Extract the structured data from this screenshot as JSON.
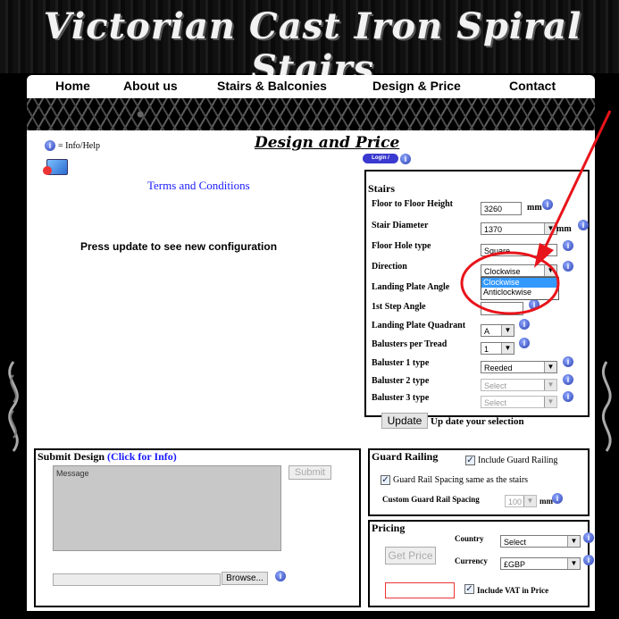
{
  "site": {
    "title": "Victorian Cast Iron Spiral Stairs"
  },
  "nav": {
    "items": [
      "Home",
      "About us",
      "Stairs & Balconies",
      "Design & Price",
      "Contact"
    ]
  },
  "page": {
    "info_help_label": "= Info/Help",
    "heading": "Design and Price",
    "login_label": "Login / Register",
    "terms_link": "Terms and Conditions",
    "update_message": "Press update to see new configuration"
  },
  "stairs": {
    "title": "Stairs",
    "floor_height_label": "Floor to Floor Height",
    "floor_height_value": "3260",
    "floor_height_unit": "mm",
    "diameter_label": "Stair Diameter",
    "diameter_value": "1370",
    "diameter_unit": "mm",
    "hole_type_label": "Floor Hole type",
    "hole_type_value": "Square",
    "direction_label": "Direction",
    "direction_value": "Clockwise",
    "direction_options": [
      "Clockwise",
      "Anticlockwise"
    ],
    "landing_angle_label": "Landing Plate Angle",
    "first_step_label": "1st Step Angle",
    "quadrant_label": "Landing Plate Quadrant",
    "quadrant_value": "A",
    "balusters_label": "Balusters per Tread",
    "balusters_value": "1",
    "b1_label": "Baluster 1 type",
    "b1_value": "Reeded",
    "b2_label": "Baluster 2 type",
    "b2_value": "Select",
    "b3_label": "Baluster 3 type",
    "b3_value": "Select",
    "update_button": "Update",
    "update_hint": "Up date your selection"
  },
  "submit": {
    "title": "Submit Design",
    "info_link": "(Click for Info)",
    "message_placeholder": "Message",
    "submit_button": "Submit",
    "browse_button": "Browse..."
  },
  "guard": {
    "title": "Guard Railing",
    "include_label": "Include Guard Railing",
    "spacing_same_label": "Guard Rail Spacing same as the stairs",
    "custom_label": "Custom Guard Rail Spacing",
    "custom_value": "100",
    "custom_unit": "mm"
  },
  "pricing": {
    "title": "Pricing",
    "country_label": "Country",
    "country_value": "Select",
    "currency_label": "Currency",
    "currency_value": "£GBP",
    "get_price_button": "Get Price",
    "vat_label": "Include VAT in Price"
  },
  "colors": {
    "annotation": "#e8141b",
    "link": "#1a1aff",
    "dropdown_highlight": "#3399ff"
  }
}
